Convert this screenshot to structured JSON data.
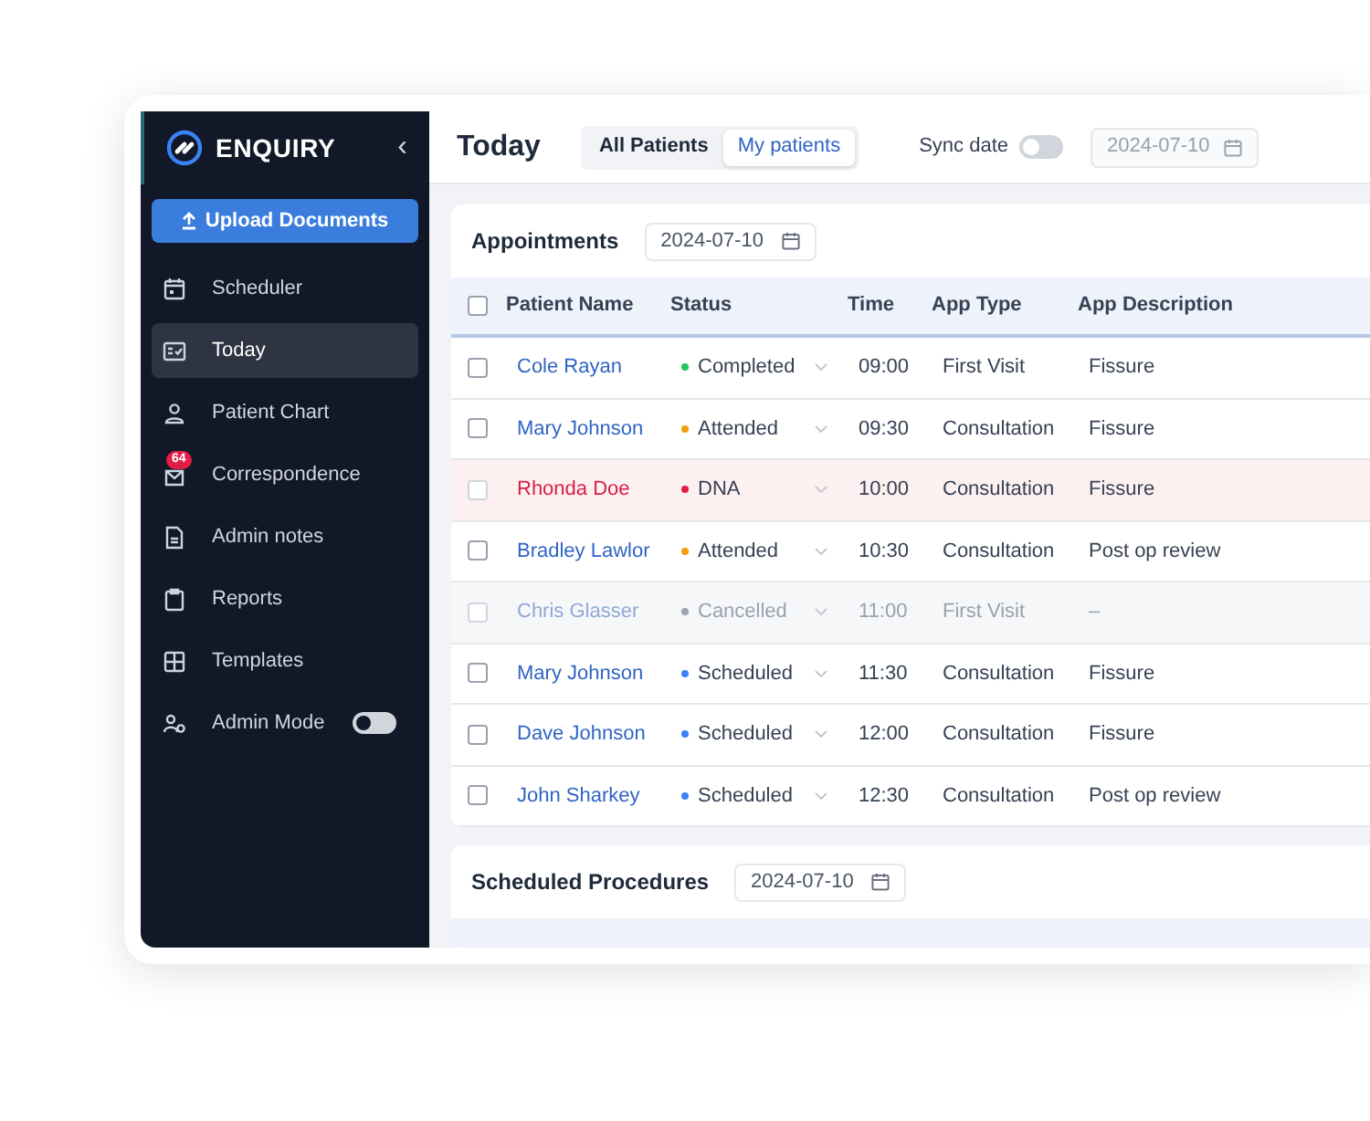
{
  "sidebar": {
    "brand": "ENQUIRY",
    "collapse": "‹",
    "upload_button": "Upload Documents",
    "items": [
      {
        "label": "Scheduler",
        "selected": false
      },
      {
        "label": "Today",
        "selected": true
      },
      {
        "label": "Patient Chart",
        "selected": false
      },
      {
        "label": "Correspondence",
        "selected": false,
        "badge": "64"
      },
      {
        "label": "Admin notes",
        "selected": false
      },
      {
        "label": "Reports",
        "selected": false
      },
      {
        "label": "Templates",
        "selected": false
      },
      {
        "label": "Admin Mode",
        "selected": false,
        "toggle": {
          "on": false
        }
      }
    ]
  },
  "header": {
    "title": "Today",
    "tabs": [
      {
        "label": "All Patients",
        "selected": false
      },
      {
        "label": "My patients",
        "selected": true
      }
    ],
    "sync": {
      "label": "Sync date",
      "on": false
    },
    "date": "2024-07-10"
  },
  "appointments": {
    "title": "Appointments",
    "date": "2024-07-10",
    "select_all": {
      "checked": false
    },
    "columns": [
      "Patient Name",
      "Status",
      "Time",
      "App Type",
      "App Description"
    ],
    "rows": [
      {
        "name": "Cole Rayan",
        "checked": false,
        "status": "Completed",
        "color": "#22c55e",
        "kind": "normal",
        "time": "09:00",
        "type": "First Visit",
        "description": "Fissure"
      },
      {
        "name": "Mary Johnson",
        "checked": false,
        "status": "Attended",
        "color": "#f59e0b",
        "kind": "normal",
        "time": "09:30",
        "type": "Consultation",
        "description": "Fissure"
      },
      {
        "name": "Rhonda Doe",
        "checked": false,
        "status": "DNA",
        "color": "#e11d48",
        "kind": "alert",
        "time": "10:00",
        "type": "Consultation",
        "description": "Fissure"
      },
      {
        "name": "Bradley Lawlor",
        "checked": false,
        "status": "Attended",
        "color": "#f59e0b",
        "kind": "normal",
        "time": "10:30",
        "type": "Consultation",
        "description": "Post op review"
      },
      {
        "name": "Chris Glasser",
        "checked": false,
        "status": "Cancelled",
        "color": "#9ca3af",
        "kind": "muted",
        "time": "11:00",
        "type": "First Visit",
        "description": "–"
      },
      {
        "name": "Mary Johnson",
        "checked": false,
        "status": "Scheduled",
        "color": "#3b82f6",
        "kind": "normal",
        "time": "11:30",
        "type": "Consultation",
        "description": "Fissure"
      },
      {
        "name": "Dave Johnson",
        "checked": false,
        "status": "Scheduled",
        "color": "#3b82f6",
        "kind": "normal",
        "time": "12:00",
        "type": "Consultation",
        "description": "Fissure"
      },
      {
        "name": "John Sharkey",
        "checked": false,
        "status": "Scheduled",
        "color": "#3b82f6",
        "kind": "normal",
        "time": "12:30",
        "type": "Consultation",
        "description": "Post op review"
      }
    ]
  },
  "procedures": {
    "title": "Scheduled Procedures",
    "date": "2024-07-10"
  }
}
